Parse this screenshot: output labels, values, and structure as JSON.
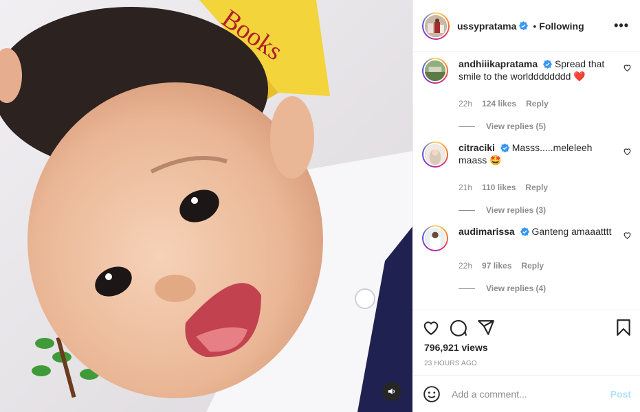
{
  "post": {
    "author": "ussypratama",
    "follow_status": "Following",
    "more_icon": "more-options-icon",
    "views": "796,921 views",
    "time_ago": "23 HOURS AGO"
  },
  "comments": [
    {
      "username": "andhiiikapratama",
      "text": "Spread that smile to the worldddddddd",
      "emoji": "❤️",
      "time": "22h",
      "likes": "124 likes",
      "reply_label": "Reply",
      "view_replies": "View replies (5)"
    },
    {
      "username": "citraciki",
      "text": "Masss.....meleleeh maass",
      "emoji": "🤩",
      "time": "21h",
      "likes": "110 likes",
      "reply_label": "Reply",
      "view_replies": "View replies (3)"
    },
    {
      "username": "audimarissa",
      "text": "Ganteng amaaatttt",
      "emoji": "",
      "time": "22h",
      "likes": "97 likes",
      "reply_label": "Reply",
      "view_replies": "View replies (4)"
    }
  ],
  "composer": {
    "placeholder": "Add a comment...",
    "post_label": "Post"
  },
  "colors": {
    "verified": "#3897f0",
    "post_disabled": "#b2dffc",
    "heart_red": "#ed4956"
  },
  "icons": [
    "heart-icon",
    "comment-icon",
    "share-icon",
    "bookmark-icon",
    "emoji-icon",
    "sound-icon",
    "verified-icon"
  ]
}
